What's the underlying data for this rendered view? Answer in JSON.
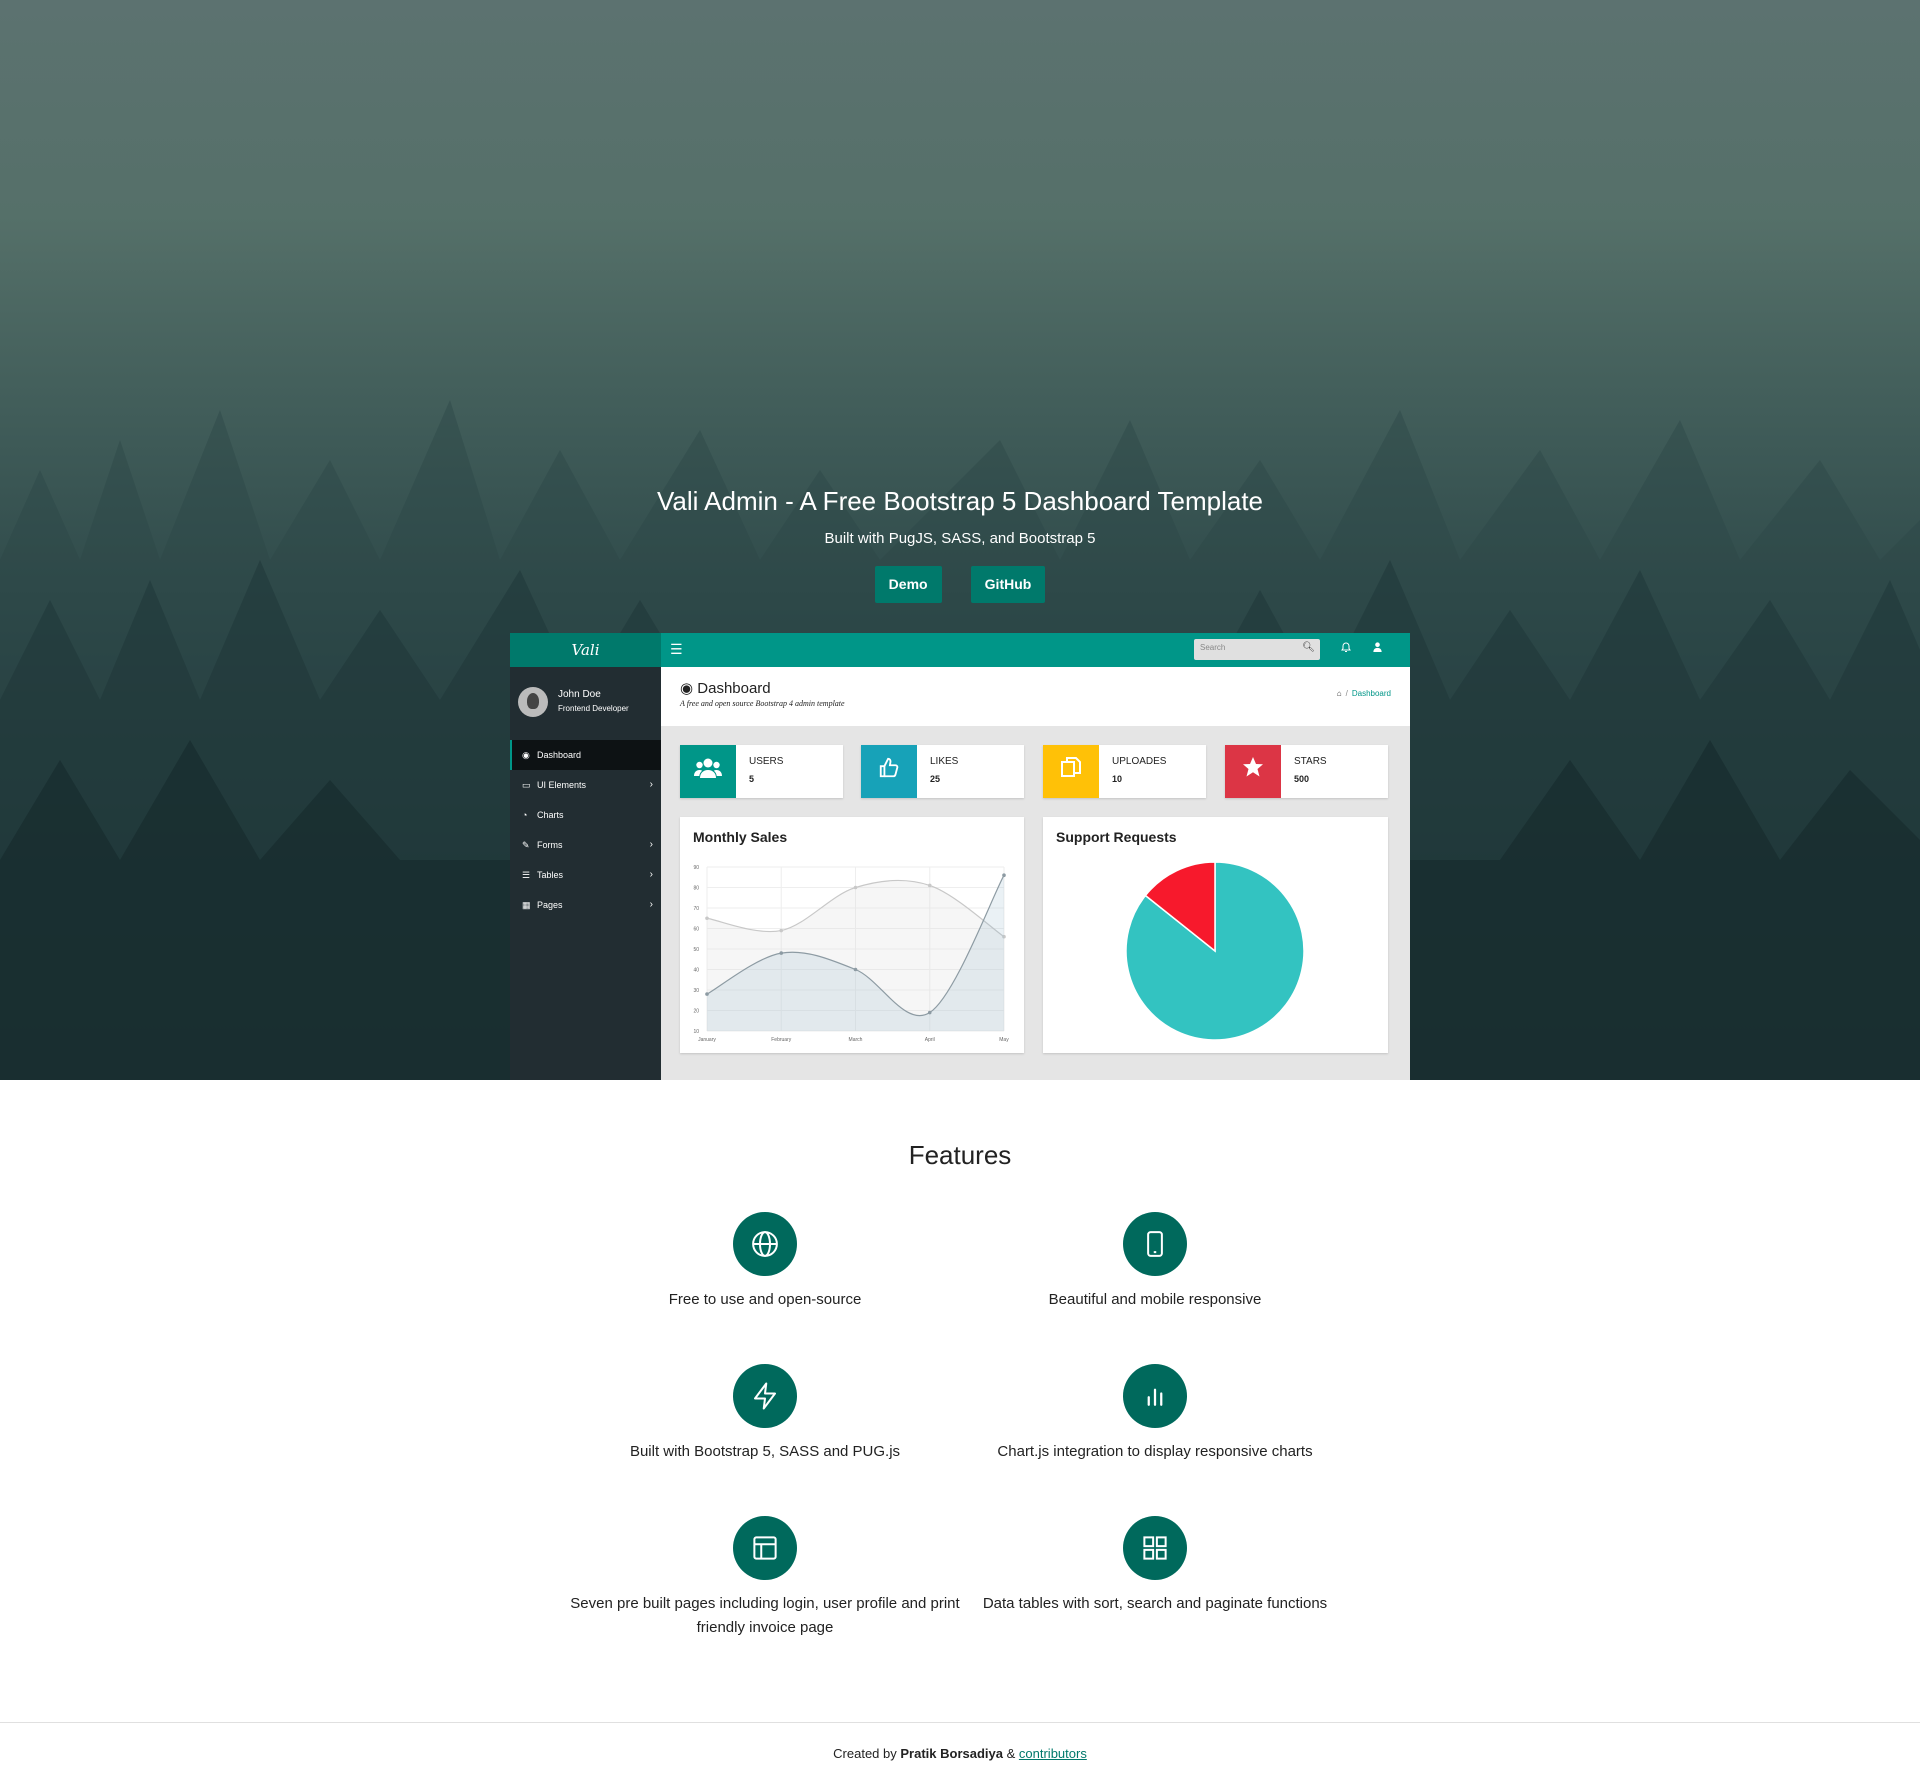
{
  "hero": {
    "title": "Vali Admin - A Free Bootstrap 5 Dashboard Template",
    "subtitle": "Built with PugJS, SASS, and Bootstrap 5",
    "demo_label": "Demo",
    "github_label": "GitHub"
  },
  "mock": {
    "logo": "Vali",
    "search_placeholder": "Search",
    "user": {
      "name": "John Doe",
      "role": "Frontend Developer"
    },
    "menu": [
      {
        "label": "Dashboard",
        "icon": "dashboard-icon",
        "active": true
      },
      {
        "label": "UI Elements",
        "icon": "laptop-icon",
        "chevron": true
      },
      {
        "label": "Charts",
        "icon": "pie-chart-icon"
      },
      {
        "label": "Forms",
        "icon": "edit-icon",
        "chevron": true
      },
      {
        "label": "Tables",
        "icon": "table-icon",
        "chevron": true
      },
      {
        "label": "Pages",
        "icon": "file-icon",
        "chevron": true
      }
    ],
    "page_title": "Dashboard",
    "page_subtitle": "A free and open source Bootstrap 4 admin template",
    "breadcrumb": "Dashboard",
    "widgets": [
      {
        "label": "USERS",
        "value": "5",
        "color": "#009688",
        "icon": "users-icon"
      },
      {
        "label": "LIKES",
        "value": "25",
        "color": "#17a2b8",
        "icon": "thumbs-up-icon"
      },
      {
        "label": "UPLOADES",
        "value": "10",
        "color": "#ffc107",
        "icon": "files-icon"
      },
      {
        "label": "STARS",
        "value": "500",
        "color": "#dc3545",
        "icon": "star-icon"
      }
    ],
    "monthly_sales_title": "Monthly Sales",
    "support_requests_title": "Support Requests"
  },
  "chart_data": [
    {
      "type": "line",
      "title": "Monthly Sales",
      "categories": [
        "January",
        "February",
        "March",
        "April",
        "May"
      ],
      "series": [
        {
          "values": [
            65,
            59,
            80,
            81,
            56
          ],
          "color": "#c8c8c8"
        },
        {
          "values": [
            28,
            48,
            40,
            19,
            86
          ],
          "color": "#8d9ba3"
        }
      ],
      "ylim": [
        10,
        90
      ],
      "yticks": [
        10,
        20,
        30,
        40,
        50,
        60,
        70,
        80,
        90
      ]
    },
    {
      "type": "pie",
      "title": "Support Requests",
      "values": [
        300,
        50
      ],
      "colors": [
        "#33c3c1",
        "#f7192c"
      ]
    }
  ],
  "features": {
    "title": "Features",
    "items": [
      {
        "text": "Free to use and open-source",
        "icon": "globe-icon"
      },
      {
        "text": "Beautiful and mobile responsive",
        "icon": "mobile-icon"
      },
      {
        "text": "Built with Bootstrap 5, SASS and PUG.js",
        "icon": "lightning-icon"
      },
      {
        "text": "Chart.js integration to display responsive charts",
        "icon": "bar-chart-icon"
      },
      {
        "text": "Seven pre built pages including login, user profile and print friendly invoice page",
        "icon": "layout-icon"
      },
      {
        "text": "Data tables with sort, search and paginate functions",
        "icon": "grid-icon"
      }
    ]
  },
  "footer": {
    "prefix": "Created by",
    "author": "Pratik Borsadiya",
    "amp": "&",
    "link": "contributors"
  },
  "colors": {
    "accent": "#00796b",
    "primary": "#009688"
  }
}
